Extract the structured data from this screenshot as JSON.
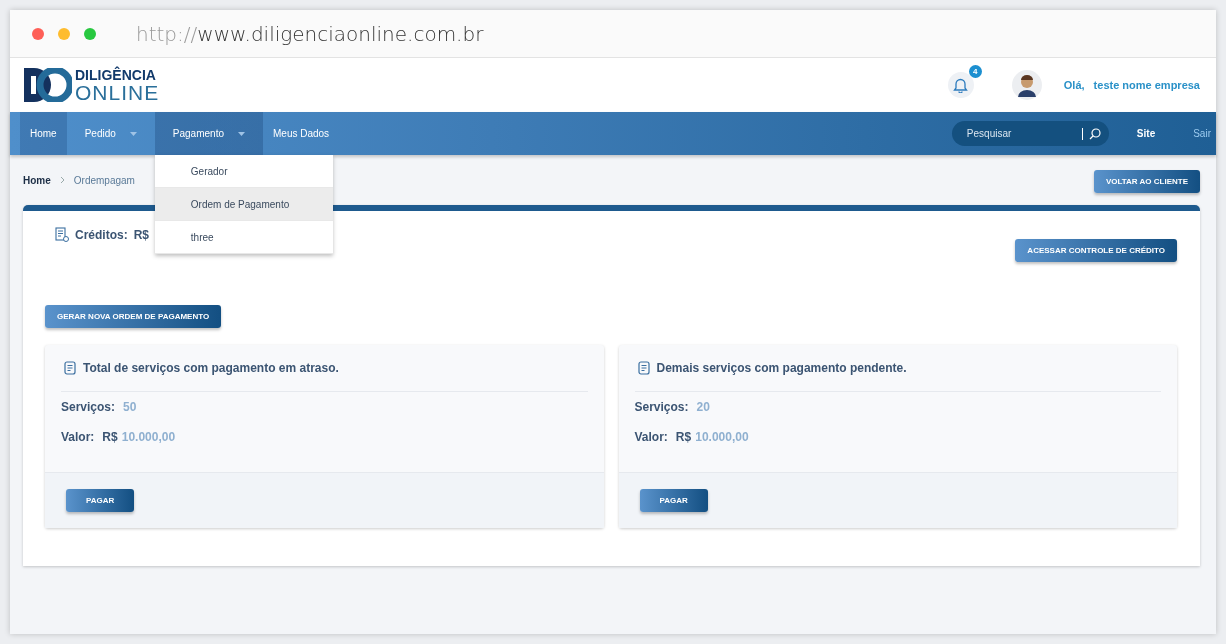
{
  "browser": {
    "url_scheme": "http://",
    "url_host": "www.diligenciaonline.com.br"
  },
  "header": {
    "logo": {
      "line1": "DILIGÊNCIA",
      "line2": "ONLINE"
    },
    "notification_count": "4",
    "greeting": "Olá,",
    "user_name": "teste nome empresa"
  },
  "nav": {
    "items": [
      {
        "label": "Home",
        "kind": "link",
        "selected": true,
        "expanded": false
      },
      {
        "label": "Pedido",
        "kind": "menu",
        "selected": false,
        "expanded": false
      },
      {
        "label": "Pagamento",
        "kind": "menu",
        "selected": false,
        "expanded": true,
        "menu": [
          {
            "label": "Gerador",
            "selected": false
          },
          {
            "label": "Ordem de Pagamento",
            "selected": true
          },
          {
            "label": "three",
            "selected": false
          }
        ]
      },
      {
        "label": "Meus Dados",
        "kind": "link",
        "selected": false,
        "expanded": false
      }
    ],
    "search": {
      "placeholder": "Pesquisar"
    },
    "links": [
      {
        "label": "Site",
        "selected": true
      },
      {
        "label": "Sair",
        "selected": false
      }
    ]
  },
  "breadcrumb": [
    "Home",
    "Ordempagam"
  ],
  "back_button": "VOLTAR AO CLIENTE",
  "credits": {
    "label": "Créditos:",
    "currency": "R$"
  },
  "credit_button": "ACESSAR CONTROLE DE CRÉDITO",
  "new_order_button": "GERAR NOVA ORDEM DE PAGAMENTO",
  "panels": [
    {
      "title": "Total de serviços com pagamento em atraso.",
      "services_label": "Serviços:",
      "services": "50",
      "value_label": "Valor:",
      "currency": "R$",
      "value": "10.000,00",
      "button": "PAGAR"
    },
    {
      "title": "Demais serviços com pagamento pendente.",
      "services_label": "Serviços:",
      "services": "20",
      "value_label": "Valor:",
      "currency": "R$",
      "value": "10.000,00",
      "button": "PAGAR"
    }
  ]
}
